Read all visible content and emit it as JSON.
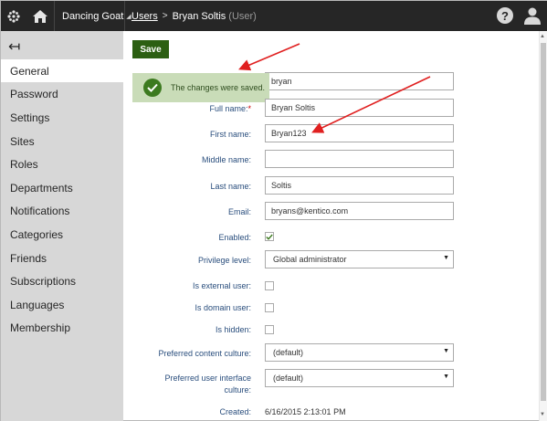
{
  "topbar": {
    "app_icon": "kentico-logo-icon",
    "home_icon": "home-icon",
    "site_name": "Dancing Goat",
    "site_caret": "◢",
    "breadcrumb": {
      "link": "Users",
      "separator": ">",
      "current": "Bryan Soltis",
      "current_suffix": "(User)"
    },
    "help_icon": "help-icon",
    "help_glyph": "?",
    "user_icon": "user-icon"
  },
  "sidebar": {
    "back_icon": "back-arrow-icon",
    "back_glyph": "↤",
    "items": [
      {
        "label": "General",
        "active": true
      },
      {
        "label": "Password"
      },
      {
        "label": "Settings"
      },
      {
        "label": "Sites"
      },
      {
        "label": "Roles"
      },
      {
        "label": "Departments"
      },
      {
        "label": "Notifications"
      },
      {
        "label": "Categories"
      },
      {
        "label": "Friends"
      },
      {
        "label": "Subscriptions"
      },
      {
        "label": "Languages"
      },
      {
        "label": "Membership"
      }
    ]
  },
  "toolbar": {
    "save_label": "Save"
  },
  "toast": {
    "message": "The changes were saved.",
    "icon": "check-circle-icon"
  },
  "form": {
    "username": {
      "value": "bryan"
    },
    "full_name": {
      "label": "Full name:",
      "required_mark": "*",
      "value": "Bryan Soltis"
    },
    "first_name": {
      "label": "First name:",
      "value": "Bryan123"
    },
    "middle_name": {
      "label": "Middle name:",
      "value": ""
    },
    "last_name": {
      "label": "Last name:",
      "value": "Soltis"
    },
    "email": {
      "label": "Email:",
      "value": "bryans@kentico.com"
    },
    "enabled": {
      "label": "Enabled:",
      "checked": true
    },
    "privilege_level": {
      "label": "Privilege level:",
      "value": "Global administrator"
    },
    "is_external_user": {
      "label": "Is external user:",
      "checked": false
    },
    "is_domain_user": {
      "label": "Is domain user:",
      "checked": false
    },
    "is_hidden": {
      "label": "Is hidden:",
      "checked": false
    },
    "preferred_content_culture": {
      "label": "Preferred content culture:",
      "value": "(default)"
    },
    "preferred_ui_culture": {
      "label_line1": "Preferred user interface",
      "label_line2": "culture:",
      "value": "(default)"
    },
    "created": {
      "label": "Created:",
      "value": "6/16/2015 2:13:01 PM"
    }
  },
  "colors": {
    "topbar": "#262626",
    "sidebar": "#d7d7d7",
    "save_button": "#2c5f12",
    "toast_bg": "#c9dcb8",
    "label": "#2a4e7d",
    "annotation_arrow": "#e02020"
  }
}
